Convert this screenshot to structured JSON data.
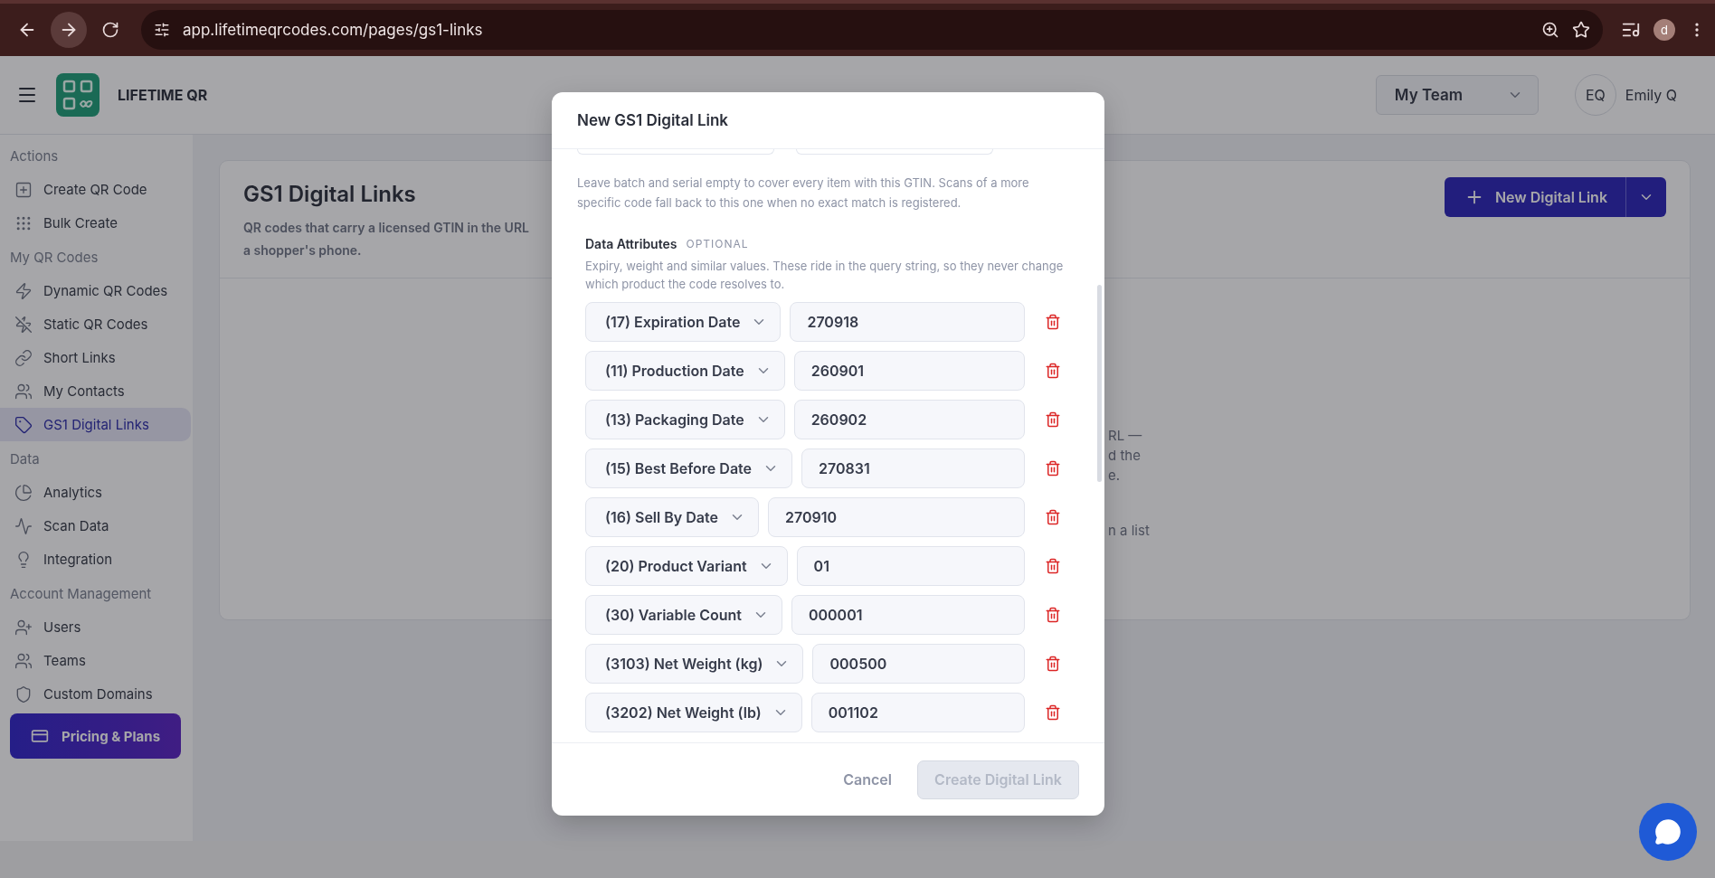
{
  "browser": {
    "url": "app.lifetimeqrcodes.com/pages/gs1-links",
    "profile_initial": "d"
  },
  "header": {
    "brand": "LIFETIME QR",
    "team_select": "My Team",
    "user": {
      "initials": "EQ",
      "name": "Emily Q"
    }
  },
  "sidebar": {
    "sections": [
      {
        "title": "Actions",
        "items": [
          {
            "label": "Create QR Code",
            "selected": false
          },
          {
            "label": "Bulk Create",
            "selected": false
          }
        ]
      },
      {
        "title": "My QR Codes",
        "items": [
          {
            "label": "Dynamic QR Codes",
            "selected": false
          },
          {
            "label": "Static QR Codes",
            "selected": false
          },
          {
            "label": "Short Links",
            "selected": false
          },
          {
            "label": "My Contacts",
            "selected": false
          },
          {
            "label": "GS1 Digital Links",
            "selected": true
          }
        ]
      },
      {
        "title": "Data",
        "items": [
          {
            "label": "Analytics",
            "selected": false
          },
          {
            "label": "Scan Data",
            "selected": false
          },
          {
            "label": "Integration",
            "selected": false
          }
        ]
      },
      {
        "title": "Account Management",
        "items": [
          {
            "label": "Users",
            "selected": false
          },
          {
            "label": "Teams",
            "selected": false
          },
          {
            "label": "Custom Domains",
            "selected": false
          }
        ]
      }
    ],
    "pricing_button": "Pricing & Plans"
  },
  "page": {
    "title": "GS1 Digital Links",
    "description_lines": [
      "QR codes that carry a licensed GTIN in the URL",
      "a shopper's phone."
    ],
    "new_button": "New Digital Link",
    "empty_state_fragments": [
      "RL —",
      "d the",
      "e.",
      "n a list"
    ]
  },
  "modal": {
    "title": "New GS1 Digital Link",
    "hint": "Leave batch and serial empty to cover every item with this GTIN. Scans of a more specific code fall back to this one when no exact match is registered.",
    "section": {
      "title": "Data Attributes",
      "badge": "OPTIONAL",
      "description": "Expiry, weight and similar values. These ride in the query string, so they never change which product the code resolves to."
    },
    "attributes": [
      {
        "label": "(17) Expiration Date",
        "value": "270918"
      },
      {
        "label": "(11) Production Date",
        "value": "260901"
      },
      {
        "label": "(13) Packaging Date",
        "value": "260902"
      },
      {
        "label": "(15) Best Before Date",
        "value": "270831"
      },
      {
        "label": "(16) Sell By Date",
        "value": "270910"
      },
      {
        "label": "(20) Product Variant",
        "value": "01"
      },
      {
        "label": "(30) Variable Count",
        "value": "000001"
      },
      {
        "label": "(3103) Net Weight (kg)",
        "value": "000500"
      },
      {
        "label": "(3202) Net Weight (lb)",
        "value": "001102"
      }
    ],
    "cancel": "Cancel",
    "create": {
      "label": "Create Digital Link",
      "disabled": true
    }
  }
}
